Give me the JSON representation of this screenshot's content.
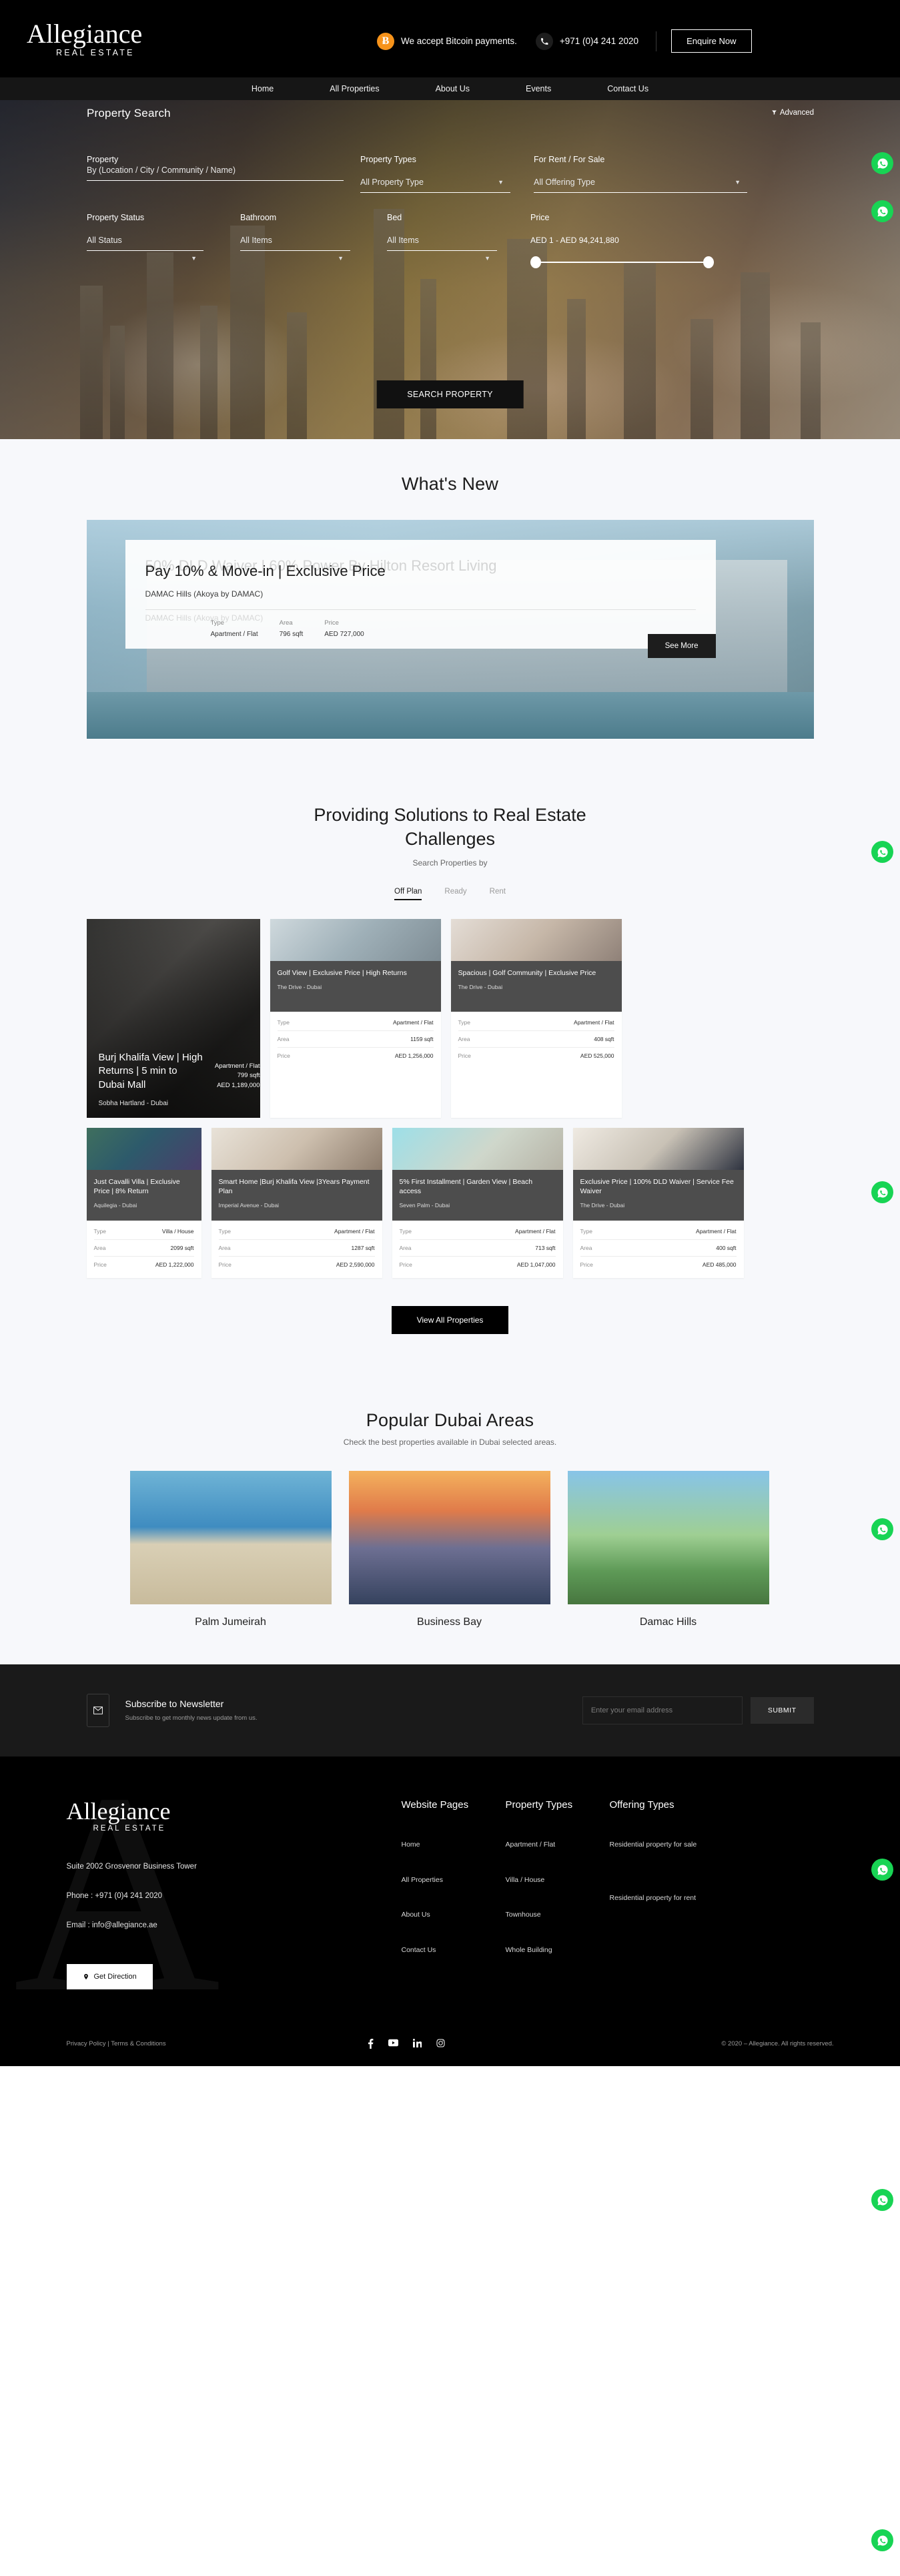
{
  "header": {
    "logo_main": "Allegiance",
    "logo_sub": "REAL ESTATE",
    "bitcoin_text": "We accept Bitcoin payments.",
    "bitcoin_symbol": "Ƀ",
    "phone": "+971 (0)4 241 2020",
    "enquire_label": "Enquire Now"
  },
  "nav": {
    "items": [
      {
        "label": "Home"
      },
      {
        "label": "All Properties"
      },
      {
        "label": "About Us"
      },
      {
        "label": "Events"
      },
      {
        "label": "Contact Us"
      }
    ]
  },
  "search": {
    "title": "Property Search",
    "advanced": "Advanced",
    "fields": {
      "property_label": "Property",
      "property_value": "By (Location / City / Community / Name)",
      "property_types_label": "Property Types",
      "property_types_value": "All Property Type",
      "rent_sale_label": "For Rent / For Sale",
      "rent_sale_value": "All Offering Type",
      "status_label": "Property Status",
      "status_value": "All Status",
      "bathroom_label": "Bathroom",
      "bathroom_value": "All Items",
      "bed_label": "Bed",
      "bed_value": "All Items",
      "price_label": "Price",
      "price_range": "AED 1 - AED 94,241,880"
    },
    "button": "SEARCH PROPERTY"
  },
  "whats_new": {
    "title": "What's New",
    "slide": {
      "title": "Pay 10% & Move-in | Exclusive Price",
      "location": "DAMAC Hills (Akoya by DAMAC)",
      "ghost_title": "50% DLD Waiver | 60% Power By Hilton Resort Living",
      "ghost_location": "DAMAC Hills (Akoya by DAMAC)",
      "table_headers": {
        "type": "Type",
        "area": "Area",
        "price": "Price"
      },
      "table_values": {
        "type": "Apartment / Flat",
        "area": "796 sqft",
        "price": "AED 727,000"
      },
      "see_more": "See More"
    },
    "prev_arrow": "‹",
    "next_arrow": "›"
  },
  "solutions": {
    "title_line1": "Providing Solutions to Real Estate",
    "title_line2": "Challenges",
    "subtitle": "Search Properties by",
    "tabs": [
      {
        "label": "Off Plan",
        "active": true
      },
      {
        "label": "Ready",
        "active": false
      },
      {
        "label": "Rent",
        "active": false
      }
    ],
    "feature_card": {
      "title": "Burj Khalifa View | High Returns | 5 min to Dubai Mall",
      "location": "Sobha Hartland - Dubai",
      "type": "Apartment / Flat",
      "area": "799 sqft",
      "price": "AED 1,189,000"
    },
    "labels": {
      "type": "Type",
      "area": "Area",
      "price": "Price"
    },
    "cards": [
      {
        "title": "Golf View | Exclusive Price | High Returns",
        "location": "The Drive - Dubai",
        "type": "Apartment / Flat",
        "area": "1159 sqft",
        "price": "AED 1,256,000"
      },
      {
        "title": "Spacious | Golf Community | Exclusive Price",
        "location": "The Drive - Dubai",
        "type": "Apartment / Flat",
        "area": "408 sqft",
        "price": "AED 525,000"
      },
      {
        "title": "Just Cavalli Villa | Exclusive Price | 8% Return",
        "location": "Aquilegia - Dubai",
        "type": "Villa / House",
        "area": "2099 sqft",
        "price": "AED 1,222,000"
      },
      {
        "title": "Smart Home |Burj Khalifa View |3Years Payment Plan",
        "location": "Imperial Avenue - Dubai",
        "type": "Apartment / Flat",
        "area": "1287 sqft",
        "price": "AED 2,590,000"
      },
      {
        "title": "5% First Installment | Garden View | Beach access",
        "location": "Seven Palm - Dubai",
        "type": "Apartment / Flat",
        "area": "713 sqft",
        "price": "AED 1,047,000"
      },
      {
        "title": "Exclusive Price | 100% DLD Waiver | Service Fee Waiver",
        "location": "The Drive - Dubai",
        "type": "Apartment / Flat",
        "area": "400 sqft",
        "price": "AED 485,000"
      }
    ],
    "view_all": "View All Properties"
  },
  "areas": {
    "title": "Popular Dubai Areas",
    "subtitle": "Check the best properties available in Dubai selected areas.",
    "items": [
      {
        "name": "Palm Jumeirah"
      },
      {
        "name": "Business Bay"
      },
      {
        "name": "Damac Hills"
      }
    ]
  },
  "newsletter": {
    "title": "Subscribe to Newsletter",
    "subtitle": "Subscribe to get monthly news update from us.",
    "placeholder": "Enter your email address",
    "value": "",
    "submit": "SUBMIT"
  },
  "footer": {
    "logo_main": "Allegiance",
    "logo_sub": "REAL ESTATE",
    "address": "Suite 2002 Grosvenor Business Tower",
    "phone": "Phone : +971 (0)4 241 2020",
    "email": "Email : info@allegiance.ae",
    "get_direction": "Get Direction",
    "columns": [
      {
        "heading": "Website Pages",
        "links": [
          "Home",
          "All Properties",
          "About Us",
          "Contact Us"
        ]
      },
      {
        "heading": "Property Types",
        "links": [
          "Apartment / Flat",
          "Villa / House",
          "Townhouse",
          "Whole Building"
        ]
      },
      {
        "heading": "Offering Types",
        "links": [
          "Residential property for sale",
          "Residential property for rent"
        ]
      }
    ],
    "privacy": "Privacy Policy | Terms & Conditions",
    "copyright": "© 2020 – Allegiance. All rights reserved.",
    "social": [
      "facebook-icon",
      "youtube-icon",
      "linkedin-icon",
      "instagram-icon"
    ]
  },
  "colors": {
    "accent_orange": "#f7931a",
    "whatsapp_green": "#18d454",
    "dark": "#000000",
    "panel_light": "#f7f8fb"
  }
}
